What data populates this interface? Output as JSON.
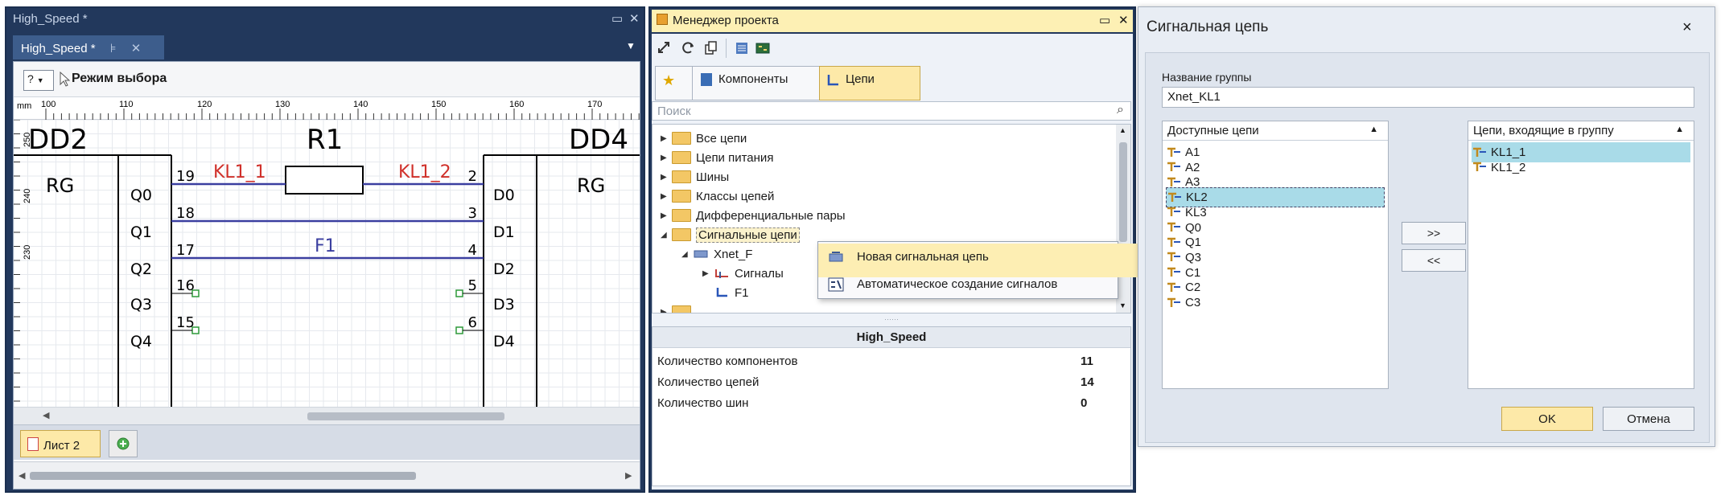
{
  "editor": {
    "title": "High_Speed *",
    "tab_label": "High_Speed *",
    "toolbar": {
      "help": "?",
      "mode": "Режим выбора"
    },
    "ruler": {
      "unit": "mm",
      "ticks": [
        "100",
        "110",
        "120",
        "130",
        "140",
        "150",
        "160",
        "170"
      ],
      "left_ticks": [
        "250",
        "240",
        "230"
      ]
    },
    "schematic": {
      "left_ref": "DD2",
      "right_ref": "DD4",
      "left_type": "RG",
      "right_type": "RG",
      "resistor": "R1",
      "nets": [
        "KL1_1",
        "KL1_2",
        "F1"
      ],
      "left_pins": [
        {
          "name": "Q0",
          "num": "19"
        },
        {
          "name": "Q1",
          "num": "18"
        },
        {
          "name": "Q2",
          "num": "17"
        },
        {
          "name": "Q3",
          "num": "16"
        },
        {
          "name": "Q4",
          "num": "15"
        }
      ],
      "right_pins": [
        {
          "name": "D0",
          "num": "2"
        },
        {
          "name": "D1",
          "num": "3"
        },
        {
          "name": "D2",
          "num": "4"
        },
        {
          "name": "D3",
          "num": "5"
        },
        {
          "name": "D4",
          "num": "6"
        }
      ]
    },
    "sheet_tab": "Лист 2"
  },
  "project_manager": {
    "title": "Менеджер проекта",
    "tabs": {
      "components": "Компоненты",
      "nets": "Цепи"
    },
    "search_placeholder": "Поиск",
    "tree": [
      "Все цепи",
      "Цепи питания",
      "Шины",
      "Классы цепей",
      "Дифференциальные пары",
      "Сигнальные цепи",
      "Xnet_F",
      "Сигналы",
      "F1"
    ],
    "context_menu": [
      "Новая сигнальная цепь",
      "Автоматическое создание сигналов"
    ],
    "props": {
      "header": "High_Speed",
      "rows": [
        {
          "key": "Количество компонентов",
          "value": "11"
        },
        {
          "key": "Количество цепей",
          "value": "14"
        },
        {
          "key": "Количество шин",
          "value": "0"
        }
      ]
    }
  },
  "dialog": {
    "title": "Сигнальная цепь",
    "close": "×",
    "group_label": "Название группы",
    "group_value": "Xnet_KL1",
    "available_header": "Доступные цепи",
    "available": [
      "A1",
      "A2",
      "A3",
      "KL2",
      "KL3",
      "Q0",
      "Q1",
      "Q3",
      "C1",
      "C2",
      "C3"
    ],
    "included_header": "Цепи, входящие в группу",
    "included": [
      "KL1_1",
      "KL1_2"
    ],
    "add_btn": ">>",
    "remove_btn": "<<",
    "ok": "OK",
    "cancel": "Отмена"
  },
  "colors": {
    "frame": "#22385c",
    "accent": "#fde9a8",
    "selection": "#a9dbe8",
    "net_line": "#3b3fa0",
    "net_label": "#d0302a"
  }
}
